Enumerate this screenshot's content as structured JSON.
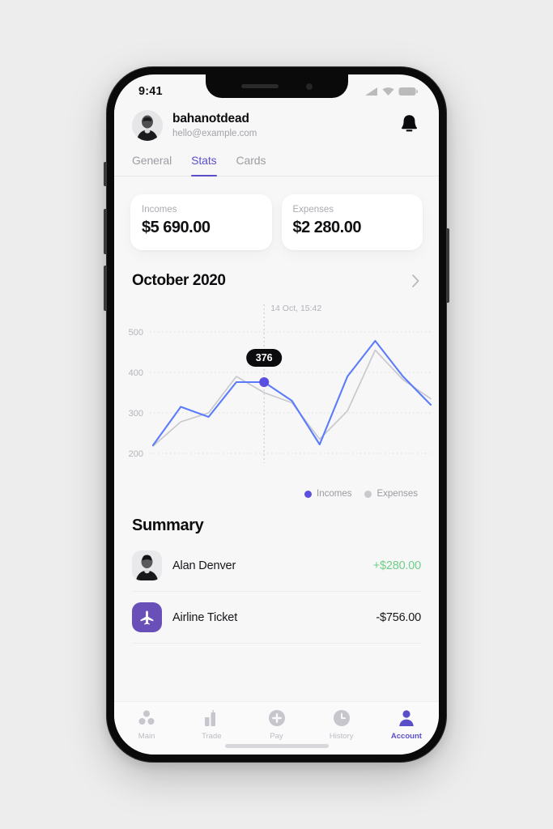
{
  "status_bar": {
    "time": "9:41",
    "icons": [
      "signal-icon",
      "wifi-icon",
      "battery-icon"
    ]
  },
  "profile": {
    "username": "bahanotdead",
    "email": "hello@example.com",
    "avatar_name": "user-avatar",
    "bell_icon": "notification-bell-icon"
  },
  "tabs": [
    {
      "label": "General",
      "active": false
    },
    {
      "label": "Stats",
      "active": true
    },
    {
      "label": "Cards",
      "active": false
    }
  ],
  "stat_cards": [
    {
      "label": "Incomes",
      "value": "$5 690.00"
    },
    {
      "label": "Expenses",
      "value": "$2 280.00"
    }
  ],
  "month_header": {
    "title": "October 2020",
    "chevron_icon": "chevron-right-icon"
  },
  "chart_data": {
    "type": "line",
    "title": "October 2020",
    "xlabel": "",
    "ylabel": "",
    "ylim": [
      180,
      520
    ],
    "yticks": [
      200,
      300,
      400,
      500
    ],
    "ytick_labels": [
      "200",
      "300",
      "400",
      "500"
    ],
    "grid": true,
    "grid_style": "dotted",
    "legend_position": "bottom-right",
    "x": [
      1,
      2,
      3,
      4,
      5,
      6,
      7,
      8,
      9,
      10,
      11
    ],
    "series": [
      {
        "name": "Incomes",
        "color": "#5b7cfa",
        "values": [
          220,
          315,
          290,
          376,
          376,
          330,
          222,
          390,
          478,
          390,
          320
        ]
      },
      {
        "name": "Expenses",
        "color": "#c9c9ce",
        "values": [
          218,
          278,
          300,
          390,
          350,
          325,
          235,
          305,
          455,
          382,
          335
        ]
      }
    ],
    "annotation": {
      "label": "14 Oct, 15:42",
      "value": "376",
      "x_index": 4,
      "marker_color": "#5b4fe0",
      "tooltip_bg": "#0c0c0e",
      "tooltip_text_color": "#ffffff"
    },
    "legend": [
      {
        "label": "Incomes",
        "color": "#5b4fe0"
      },
      {
        "label": "Expenses",
        "color": "#c9c9ce"
      }
    ]
  },
  "summary": {
    "title": "Summary",
    "rows": [
      {
        "name": "Alan Denver",
        "amount": "+$280.00",
        "amount_type": "positive",
        "icon_name": "contact-avatar-icon"
      },
      {
        "name": "Airline Ticket",
        "amount": "-$756.00",
        "amount_type": "negative",
        "icon_name": "airplane-icon"
      }
    ]
  },
  "tab_bar": [
    {
      "label": "Main",
      "icon": "dots-grid-icon",
      "active": false
    },
    {
      "label": "Trade",
      "icon": "bar-chart-icon",
      "active": false
    },
    {
      "label": "Pay",
      "icon": "plus-circle-icon",
      "active": false
    },
    {
      "label": "History",
      "icon": "clock-icon",
      "active": false
    },
    {
      "label": "Account",
      "icon": "person-icon",
      "active": true
    }
  ],
  "colors": {
    "accent_purple": "#5b4fc9",
    "icon_purple": "#6950b8",
    "income_blue": "#5b7cfa",
    "expense_gray": "#c9c9ce",
    "positive_green": "#6fcf88",
    "screen_bg": "#f7f7f8"
  }
}
